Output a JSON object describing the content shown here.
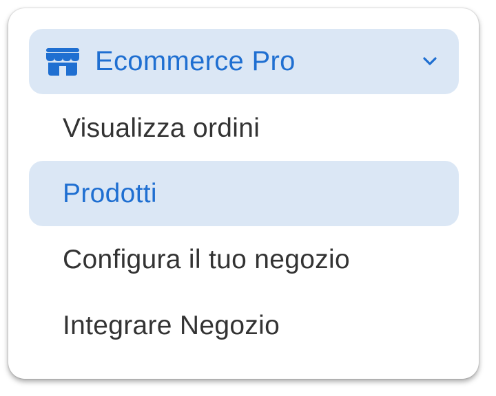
{
  "menu": {
    "header": {
      "label": "Ecommerce Pro",
      "icon": "store-icon",
      "expand_icon": "chevron-down-icon"
    },
    "items": [
      {
        "label": "Visualizza ordini",
        "selected": false
      },
      {
        "label": "Prodotti",
        "selected": true
      },
      {
        "label": "Configura il tuo negozio",
        "selected": false
      },
      {
        "label": "Integrare Negozio",
        "selected": false
      }
    ]
  },
  "colors": {
    "accent": "#1f6fd1",
    "highlight_bg": "#dbe7f5",
    "text": "#333333",
    "card_bg": "#ffffff"
  }
}
